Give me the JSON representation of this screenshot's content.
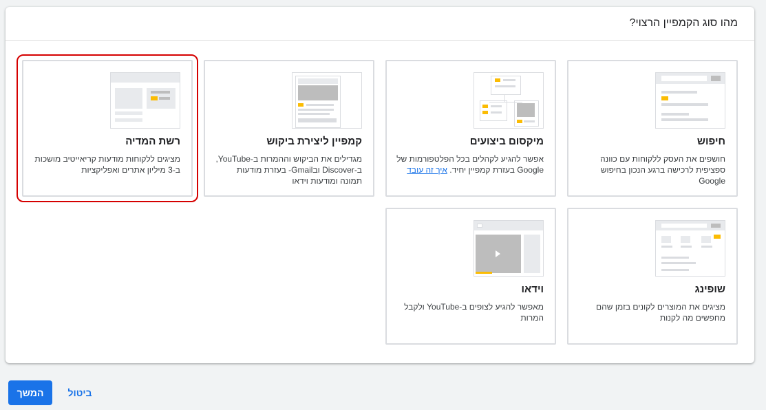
{
  "header": {
    "title": "מהו סוג הקמפיין הרצוי?"
  },
  "cards": {
    "search": {
      "title": "חיפוש",
      "description": "חושפים את העסק ללקוחות עם כוונה ספציפית לרכישה ברגע הנכון בחיפוש Google"
    },
    "performance_max": {
      "title": "מיקסום ביצועים",
      "description": "אפשר להגיע לקהלים בכל הפלטפורמות של Google בעזרת קמפיין יחיד.",
      "link": "איך זה עובד"
    },
    "demand_gen": {
      "title": "קמפיין ליצירת ביקוש",
      "description": "מגדילים את הביקוש וההמרות ב-YouTube, ב-Discover ובGmail- בעזרת מודעות תמונה ומודעות וידאו"
    },
    "display": {
      "title": "רשת המדיה",
      "description": "מציגים ללקוחות מודעות קריאייטיב מושכות ב-3 מיליון אתרים ואפליקציות"
    },
    "shopping": {
      "title": "שופינג",
      "description": "מציגים את המוצרים לקונים בזמן שהם מחפשים מה לקנות"
    },
    "video": {
      "title": "וידאו",
      "description": "מאפשר להגיע לצופים ב-YouTube ולקבל המרות"
    }
  },
  "footer": {
    "continue_label": "המשך",
    "cancel_label": "ביטול"
  },
  "colors": {
    "accent": "#1a73e8",
    "selected_outline": "#d50000",
    "illustration_yellow": "#fbbc04"
  },
  "selected_card": "display"
}
